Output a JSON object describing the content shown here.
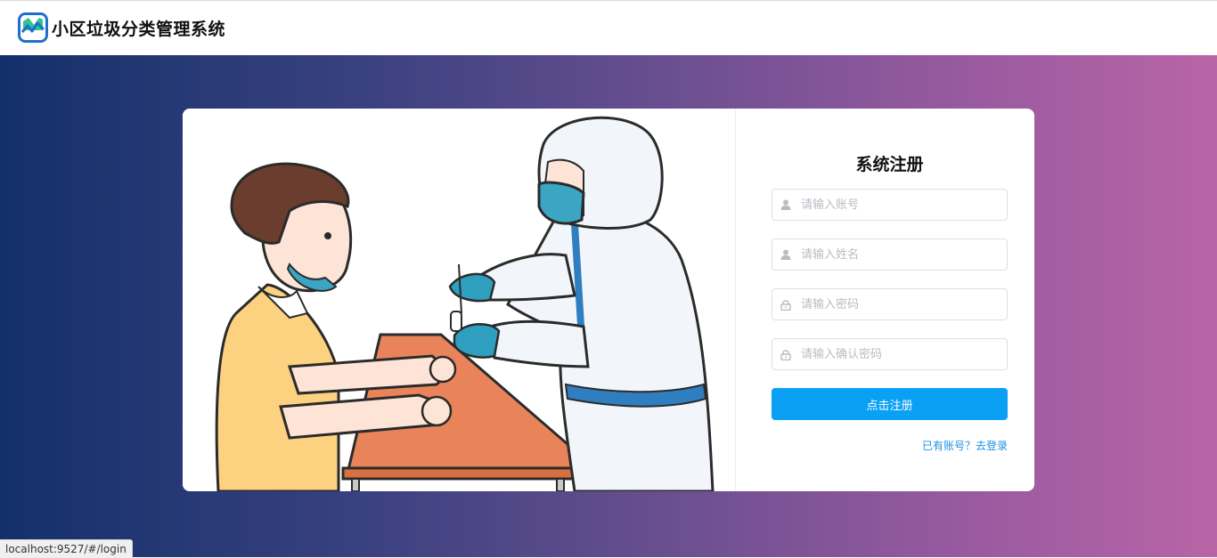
{
  "header": {
    "logo_icon": "chart-logo-icon",
    "title": "小区垃圾分类管理系统"
  },
  "form": {
    "title": "系统注册",
    "fields": [
      {
        "icon": "user-icon",
        "placeholder": "请输入账号",
        "value": ""
      },
      {
        "icon": "user-icon",
        "placeholder": "请输入姓名",
        "value": ""
      },
      {
        "icon": "lock-icon",
        "placeholder": "请输入密码",
        "value": ""
      },
      {
        "icon": "lock-icon",
        "placeholder": "请输入确认密码",
        "value": ""
      }
    ],
    "submit_label": "点击注册",
    "login_link": "已有账号？去登录"
  },
  "status": {
    "url": "localhost:9527/#/login"
  },
  "colors": {
    "primary_button": "#0aa1f5",
    "link": "#1e90e0",
    "gradient_start": "#13306a",
    "gradient_end": "#b865a6"
  }
}
